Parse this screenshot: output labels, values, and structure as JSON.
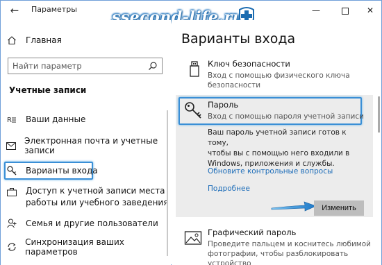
{
  "window": {
    "title": "Параметры",
    "back_symbol": "←",
    "minimize_symbol": "—",
    "close_symbol": "✕"
  },
  "watermark": {
    "text": "ssecond-life.ru",
    "color": "#1c6cb0"
  },
  "sidebar": {
    "home_label": "Главная",
    "search_placeholder": "Найти параметр",
    "section_title": "Учетные записи",
    "items": [
      {
        "label": "Ваши данные",
        "icon": "user-card-icon"
      },
      {
        "label": "Электронная почта и учетные записи",
        "icon": "mail-icon"
      },
      {
        "label": "Варианты входа",
        "icon": "key-icon"
      },
      {
        "label": "Доступ к учетной записи места работы или учебного заведения",
        "icon": "briefcase-icon"
      },
      {
        "label": "Семья и другие пользователи",
        "icon": "add-user-icon"
      },
      {
        "label": "Синхронизация ваших параметров",
        "icon": "sync-icon"
      }
    ]
  },
  "content": {
    "page_title": "Варианты входа",
    "security_key": {
      "title": "Ключ безопасности",
      "desc_line1": "Вход с помощью физического ключа",
      "desc_line2": "безопасности"
    },
    "password": {
      "title": "Пароль",
      "desc": "Вход с помощью пароля учетной записи",
      "info_line1": "Ваш пароль учетной записи готов к тому,",
      "info_line2": "чтобы вы с помощью него входили в",
      "info_line3": "Windows, приложения и службы.",
      "link_update": "Обновите контрольные вопросы",
      "link_more": "Подробнее",
      "change_button": "Изменить"
    },
    "picture_password": {
      "title": "Графический пароль",
      "desc_line1": "Проведите пальцем и коснитесь любимой",
      "desc_line2": "фотографии, чтобы разблокировать",
      "desc_line3": "устройство"
    }
  },
  "colors": {
    "accent": "#3a8fd6",
    "link": "#1a6bb8",
    "expanded_bg": "#ececec",
    "button_bg": "#bdbdbd"
  }
}
